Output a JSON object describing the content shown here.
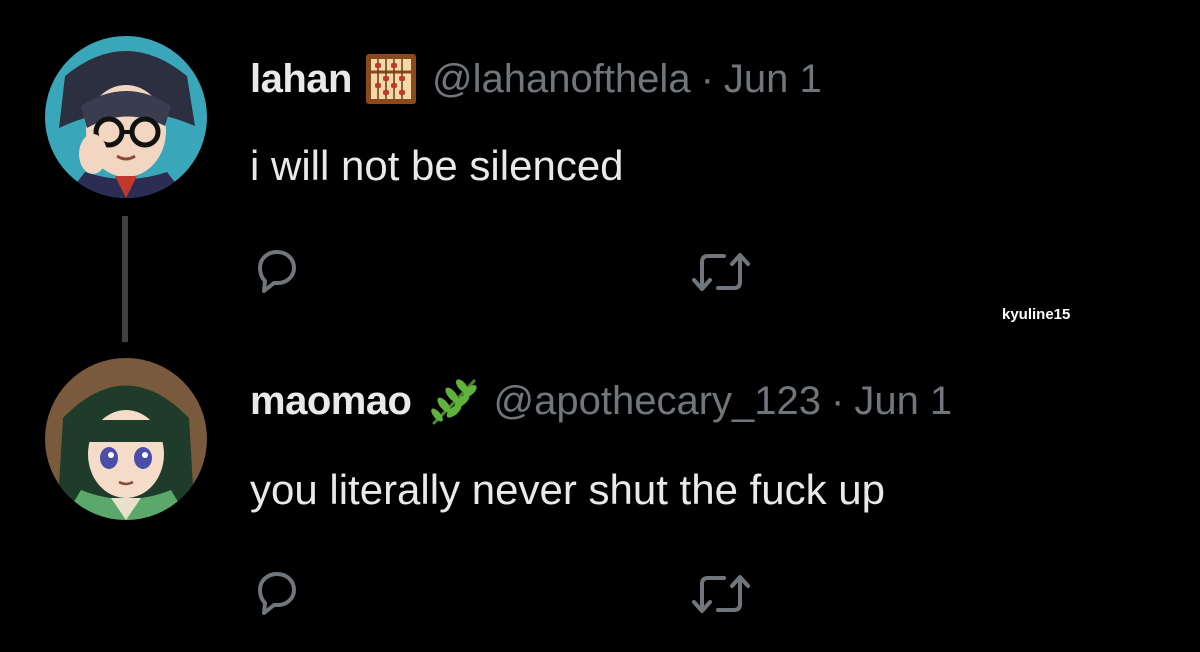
{
  "tweets": [
    {
      "display_name": "lahan",
      "badge_icon": "abacus-icon",
      "handle": "@lahanofthela",
      "separator": "·",
      "date": "Jun 1",
      "text": "i will not be silenced",
      "avatar_bg": "#3aa6b9"
    },
    {
      "display_name": "maomao",
      "badge_icon": "herb-icon",
      "handle": "@apothecary_123",
      "separator": "·",
      "date": "Jun 1",
      "text": "you literally never shut the fuck up",
      "avatar_bg": "#5a8a5e"
    }
  ],
  "watermark": "kyuline15",
  "colors": {
    "background": "#000000",
    "primary_text": "#e7e9ea",
    "secondary_text": "#71767b",
    "thread_line": "#3e4144"
  }
}
